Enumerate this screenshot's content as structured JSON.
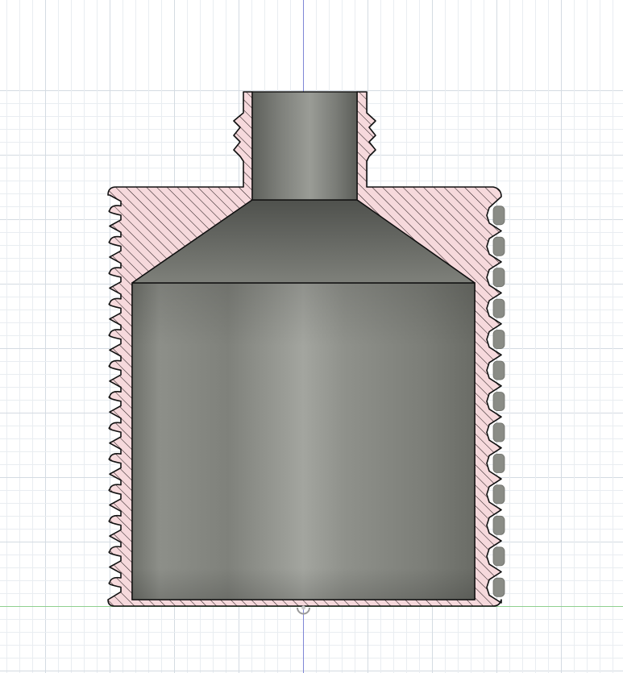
{
  "viewport": {
    "background": "#ffffff",
    "grid_minor_color": "#e9edf1",
    "grid_major_color": "#d4dbe2",
    "axis_vertical_color": "#7f86d6",
    "axis_horizontal_color": "#8fd08f"
  },
  "section_view": {
    "hatch_fill": "#f6d9dc",
    "hatch_line": "#2a1f21",
    "outline": "#111111",
    "interior_dark": "#6f716b",
    "interior_mid": "#8a8c86",
    "interior_light": "#a3a59f"
  },
  "icons": {
    "origin_marker": "origin-point-icon"
  }
}
